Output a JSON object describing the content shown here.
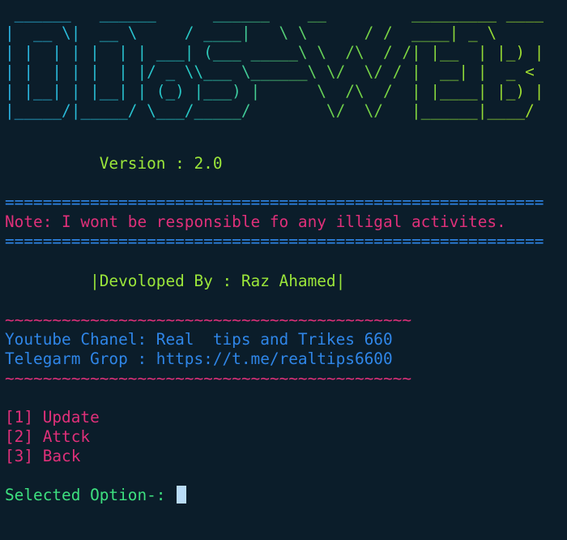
{
  "banner": {
    "lines": [
      " ______   ______      ______    __         _________ ____",
      "|  __ \\|  __ \\     / ____|   \\ \\      / /  ____| _ \\",
      "| |  | | |  | | ___| (___ _____\\ \\  /\\  / /| |__  | |_) |",
      "| |  | | |  | |/ _ \\\\___ \\______\\ \\/  \\/ / |  __| |  _ <",
      "| |__| | |__| | (_) |___) |      \\  /\\  /  | |____| |_) |",
      "|_____/|_____/ \\___/_____/        \\/  \\/   |______|____/"
    ]
  },
  "version_line": "          Version : 2.0",
  "divider_equals": "=========================================================",
  "note": "Note: I wont be responsible fo any illigal activites.",
  "developer": "         |Devoloped By : Raz Ahamed|",
  "divider_tilde": "~~~~~~~~~~~~~~~~~~~~~~~~~~~~~~~~~~~~~~~~~~~",
  "youtube": "Youtube Chanel: Real  tips and Trikes 660",
  "telegram": "Telegarm Grop : https://t.me/realtips6600",
  "menu": {
    "items": [
      "[1] Update",
      "[2] Attck",
      "[3] Back"
    ]
  },
  "prompt": "Selected Option-: ",
  "colors": {
    "background": "#0b1d2a",
    "green": "#9be63a",
    "blue": "#2f86e8",
    "pink": "#e0307a",
    "mint": "#3de07f",
    "cursor": "#b9dcf7"
  }
}
